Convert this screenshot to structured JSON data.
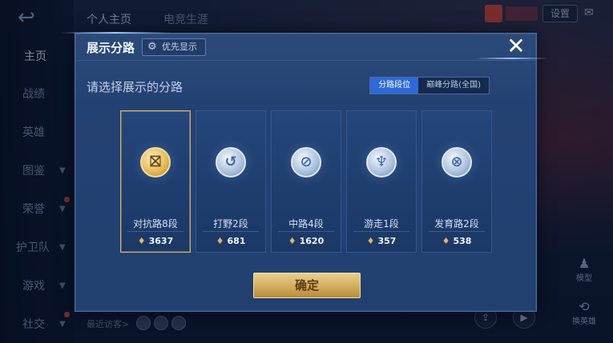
{
  "background": {
    "back_icon": "↩",
    "nav": [
      {
        "label": "主页",
        "active": true
      },
      {
        "label": "战绩",
        "active": false
      },
      {
        "label": "英雄",
        "active": false
      },
      {
        "label": "图鉴",
        "active": false
      },
      {
        "label": "荣誉",
        "active": false
      },
      {
        "label": "护卫队",
        "active": false
      },
      {
        "label": "游戏",
        "active": false
      },
      {
        "label": "社交",
        "active": false
      }
    ],
    "top_tabs": [
      "个人主页",
      "电竞生涯"
    ],
    "settings_label": "设置",
    "recent_visitors_label": "最近访客>",
    "right_buttons": [
      "模型",
      "换英雄"
    ]
  },
  "dialog": {
    "title": "展示分路",
    "priority_label": "优先显示",
    "close_icon": "✕",
    "prompt": "请选择展示的分路",
    "segments": [
      "分路段位",
      "巅峰分路(全国)"
    ],
    "cards": [
      {
        "label": "对抗路8段",
        "score": "3637",
        "icon": "sword-shield-icon",
        "selected": true
      },
      {
        "label": "打野2段",
        "score": "681",
        "icon": "claw-icon",
        "selected": false
      },
      {
        "label": "中路4段",
        "score": "1620",
        "icon": "mid-lane-icon",
        "selected": false
      },
      {
        "label": "游走1段",
        "score": "357",
        "icon": "wings-icon",
        "selected": false
      },
      {
        "label": "发育路2段",
        "score": "538",
        "icon": "crosshair-icon",
        "selected": false
      }
    ],
    "confirm_label": "确定"
  },
  "colors": {
    "accent_blue": "#2d6ad6",
    "gold": "#d9b36a",
    "dialog_bg": "#244173"
  }
}
